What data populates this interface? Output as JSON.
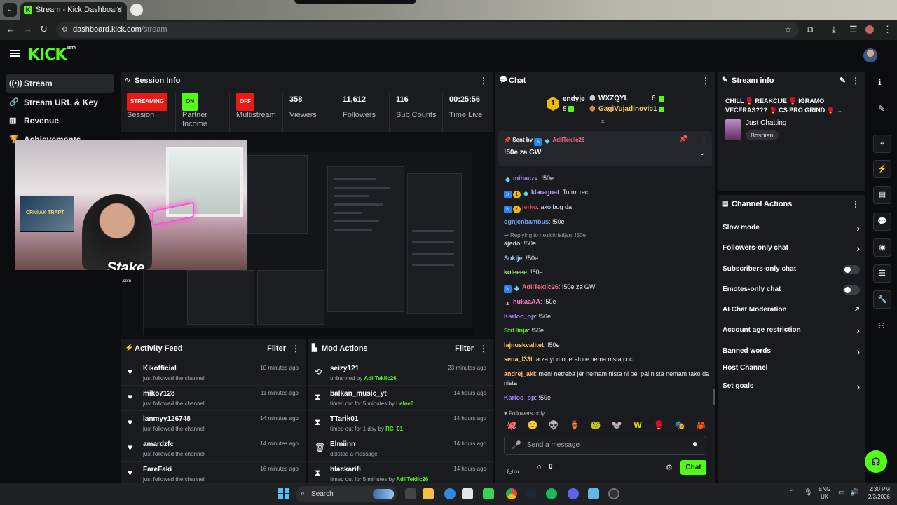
{
  "browser": {
    "tab_title": "Stream - Kick Dashboard",
    "tab_favicon": "K",
    "url_host": "dashboard.kick.com",
    "url_path": "/stream"
  },
  "app": {
    "logo": "KICK",
    "logo_sup": "BETA",
    "accent": "#53fc18"
  },
  "sidebar": {
    "items": [
      {
        "label": "Stream",
        "icon": "broadcast-icon",
        "glyph": "((•))"
      },
      {
        "label": "Stream URL & Key",
        "icon": "link-icon",
        "glyph": "🔗"
      },
      {
        "label": "Revenue",
        "icon": "revenue-icon",
        "glyph": "▥"
      },
      {
        "label": "Achievements",
        "icon": "trophy-icon",
        "glyph": "🏆"
      }
    ]
  },
  "session": {
    "title": "Session Info",
    "stats": [
      {
        "value": "STREAMING",
        "label": "Session",
        "kind": "red"
      },
      {
        "value": "ON",
        "label": "Partner Income",
        "kind": "green"
      },
      {
        "value": "OFF",
        "label": "Multistream",
        "kind": "red"
      },
      {
        "value": "358",
        "label": "Viewers"
      },
      {
        "value": "11,612",
        "label": "Followers"
      },
      {
        "value": "116",
        "label": "Sub Counts"
      },
      {
        "value": "00:25:56",
        "label": "Time Live"
      }
    ]
  },
  "webcam": {
    "overlay_brand": "Stake",
    "overlay_sub": ".com",
    "poster_text": "CRNIIAK TRAPT"
  },
  "activity": {
    "title": "Activity Feed",
    "filter": "Filter",
    "items": [
      {
        "name": "Kikofficial",
        "desc": "just followed the channel",
        "time": "10 minutes ago"
      },
      {
        "name": "miko7128",
        "desc": "just followed the channel",
        "time": "11 minutes ago"
      },
      {
        "name": "lanmyy126748",
        "desc": "just followed the channel",
        "time": "14 minutes ago"
      },
      {
        "name": "amardzfc",
        "desc": "just followed the channel",
        "time": "14 minutes ago"
      },
      {
        "name": "FareFaki",
        "desc": "just followed the channel",
        "time": "16 minutes ago"
      }
    ]
  },
  "mod": {
    "title": "Mod Actions",
    "filter": "Filter",
    "items": [
      {
        "name": "seizy121",
        "desc": "unbanned by ",
        "by": "AdilTeklic26",
        "time": "23 minutes ago",
        "glyph": "⟲"
      },
      {
        "name": "balkan_music_yt",
        "desc": "timed out for 5 minutes by ",
        "by": "Lelee0",
        "time": "14 hours ago",
        "glyph": "⧗"
      },
      {
        "name": "TTarik01",
        "desc": "timed out for 1 day by ",
        "by": "RC_01",
        "time": "14 hours ago",
        "glyph": "⧗"
      },
      {
        "name": "Elmiinn",
        "desc": "deleted a message",
        "by": "",
        "time": "14 hours ago",
        "glyph": "🗑"
      },
      {
        "name": "blackarifi",
        "desc": "timed out for 5 minutes by ",
        "by": "AdilTeklic26",
        "time": "14 hours ago",
        "glyph": "⧗"
      }
    ]
  },
  "chat": {
    "title": "Chat",
    "leaderboard": {
      "top_name": "endyje",
      "top_count": "8",
      "second_name": "WXZQYL",
      "second_count": "6",
      "third_name": "GagiVujadinovic",
      "third_count": "1"
    },
    "pinned": {
      "sent_by_label": "Sent by",
      "user": "AdilTeklic26",
      "message": "!50e za GW"
    },
    "messages": [
      {
        "user": "mihaczv",
        "color": "#b490ff",
        "text": ": !50e",
        "badges": "dia"
      },
      {
        "user": "klaragoat",
        "color": "#c7a2ff",
        "text": ": To mi reci",
        "badges": "blue-gold-dia"
      },
      {
        "user": "jerko",
        "color": "#e03a3a",
        "text": ": ako bog da",
        "badges": "blue-gold"
      },
      {
        "user": "ognjenbambus",
        "color": "#6fa8ff",
        "text": ": !50e",
        "badges": ""
      },
      {
        "user": "ajedo",
        "color": "#c7c7c7",
        "text": ": !50e",
        "badges": "",
        "reply": "Replying to nezickristijan: !50e"
      },
      {
        "user": "Sokije",
        "color": "#9ad1ff",
        "text": ": !50e",
        "badges": ""
      },
      {
        "user": "koleeee",
        "color": "#8fe388",
        "text": ": !50e",
        "badges": ""
      },
      {
        "user": "AdilTeklic26",
        "color": "#ff6b8b",
        "text": ": !50e za GW",
        "badges": "blue-dia"
      },
      {
        "user": "hukaaAA",
        "color": "#ff7fd0",
        "text": ": !50e",
        "badges": "pink"
      },
      {
        "user": "Karloo_op",
        "color": "#a17bff",
        "text": ": !50e",
        "badges": ""
      },
      {
        "user": "StrHinja",
        "color": "#53fc18",
        "text": ": !50e",
        "badges": ""
      },
      {
        "user": "lajnuskvalitet",
        "color": "#ffcf5c",
        "text": ": !50e",
        "badges": ""
      },
      {
        "user": "sena_l33t",
        "color": "#ffcf5c",
        "text": ": a za yt moderatore nema nista ccc",
        "badges": ""
      },
      {
        "user": "andrej_aki",
        "color": "#ffb37a",
        "text": ": meni netreba jer nemam nista ni pej pal nista nemam tako da nista",
        "badges": ""
      },
      {
        "user": "Karloo_op",
        "color": "#a17bff",
        "text": ": !50e",
        "badges": ""
      }
    ],
    "followers_only": "Followers only",
    "emotes": [
      "🐙",
      "🙂",
      "👽",
      "🏺",
      "🐸",
      "🐭",
      "W",
      "🥊",
      "🎭",
      "🦀"
    ],
    "input_placeholder": "Send a message",
    "points_value": "0",
    "send_label": "Chat"
  },
  "stream_info": {
    "title": "Stream info",
    "stream_title": "CHILL 🥊 REAKCIJE 🥊 IGRAMO VECERAS??? 🥊 CS PRO GRIND 🥊 ...",
    "category": "Just Chatting",
    "tag": "Bosnian"
  },
  "channel_actions": {
    "title": "Channel Actions",
    "items": [
      {
        "label": "Slow mode",
        "control": "arrow"
      },
      {
        "label": "Followers-only chat",
        "control": "arrow"
      },
      {
        "label": "Subscribers-only chat",
        "control": "toggle"
      },
      {
        "label": "Emotes-only chat",
        "control": "toggle"
      },
      {
        "label": "AI Chat Moderation",
        "control": "ext"
      },
      {
        "label": "Account age restriction",
        "control": "arrow"
      },
      {
        "label": "Banned words",
        "control": "arrow"
      },
      {
        "label": "Host Channel",
        "control": "none"
      },
      {
        "label": "Set goals",
        "control": "arrow"
      }
    ]
  },
  "taskbar": {
    "search": "Search",
    "lang_top": "ENG",
    "lang_bottom": "UK",
    "time": "2:30 PM",
    "date": "2/3/2026"
  }
}
